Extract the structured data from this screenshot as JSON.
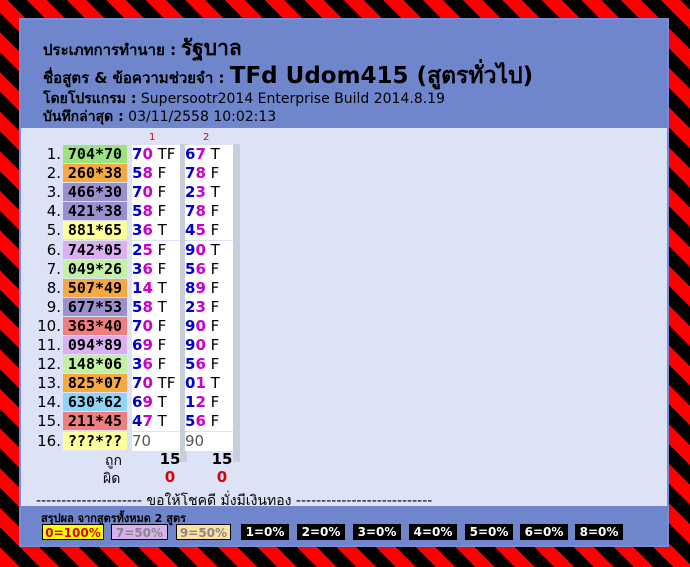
{
  "header": {
    "type_label": "ประเภทการทำนาย :",
    "type_value": "รัฐบาล",
    "formula_label": "ชื่อสูตร & ข้อความช่วยจำ :",
    "formula_value": "TFd Udom415 (สูตรทั่วไป)",
    "program_label": "โดยโปรแกรม :",
    "program_value": "Supersootr2014 Enterprise Build 2014.8.19",
    "saved_label": "บันทึกล่าสุด :",
    "saved_value": "03/11/2558 10:02:13"
  },
  "columns": [
    "1",
    "2"
  ],
  "rows": [
    {
      "n": "1.",
      "pair": "704*70",
      "bg": "#9be37e",
      "c1": [
        "7",
        "0",
        " TF"
      ],
      "c2": [
        "6",
        "7",
        " T"
      ]
    },
    {
      "n": "2.",
      "pair": "260*38",
      "bg": "#f6a841",
      "c1": [
        "5",
        "8",
        " F"
      ],
      "c2": [
        "7",
        "8",
        " F"
      ]
    },
    {
      "n": "3.",
      "pair": "466*30",
      "bg": "#9b8fce",
      "c1": [
        "7",
        "0",
        " F"
      ],
      "c2": [
        "2",
        "3",
        " T"
      ]
    },
    {
      "n": "4.",
      "pair": "421*38",
      "bg": "#9b8fce",
      "c1": [
        "5",
        "8",
        " F"
      ],
      "c2": [
        "7",
        "8",
        " F"
      ]
    },
    {
      "n": "5.",
      "pair": "881*65",
      "bg": "#ffff9c",
      "c1": [
        "3",
        "6",
        " T"
      ],
      "c2": [
        "4",
        "5",
        " F"
      ]
    },
    {
      "n": "6.",
      "pair": "742*05",
      "bg": "#d9b1f0",
      "c1": [
        "2",
        "5",
        " F"
      ],
      "c2": [
        "9",
        "0",
        " T"
      ]
    },
    {
      "n": "7.",
      "pair": "049*26",
      "bg": "#c4f0a4",
      "c1": [
        "3",
        "6",
        " F"
      ],
      "c2": [
        "5",
        "6",
        " F"
      ]
    },
    {
      "n": "8.",
      "pair": "507*49",
      "bg": "#f6a841",
      "c1": [
        "1",
        "4",
        " T"
      ],
      "c2": [
        "8",
        "9",
        " F"
      ]
    },
    {
      "n": "9.",
      "pair": "677*53",
      "bg": "#9b8fce",
      "c1": [
        "5",
        "8",
        " T"
      ],
      "c2": [
        "2",
        "3",
        " F"
      ]
    },
    {
      "n": "10.",
      "pair": "363*40",
      "bg": "#ef7f7f",
      "c1": [
        "7",
        "0",
        " F"
      ],
      "c2": [
        "9",
        "0",
        " F"
      ]
    },
    {
      "n": "11.",
      "pair": "094*89",
      "bg": "#d9b1f0",
      "c1": [
        "6",
        "9",
        " F"
      ],
      "c2": [
        "9",
        "0",
        " F"
      ]
    },
    {
      "n": "12.",
      "pair": "148*06",
      "bg": "#c4f0a4",
      "c1": [
        "3",
        "6",
        " F"
      ],
      "c2": [
        "5",
        "6",
        " F"
      ]
    },
    {
      "n": "13.",
      "pair": "825*07",
      "bg": "#f6a841",
      "c1": [
        "7",
        "0",
        " TF"
      ],
      "c2": [
        "0",
        "1",
        " T"
      ]
    },
    {
      "n": "14.",
      "pair": "630*62",
      "bg": "#8fd3f5",
      "c1": [
        "6",
        "9",
        " T"
      ],
      "c2": [
        "1",
        "2",
        " F"
      ]
    },
    {
      "n": "15.",
      "pair": "211*45",
      "bg": "#ef7f7f",
      "c1": [
        "4",
        "7",
        " T"
      ],
      "c2": [
        "5",
        "6",
        " F"
      ]
    },
    {
      "n": "16.",
      "pair": "???*??",
      "bg": "#ffff9c",
      "c1": [
        "70",
        "",
        ""
      ],
      "c2": [
        "90",
        "",
        ""
      ]
    }
  ],
  "totals": {
    "correct_label": "ถูก",
    "wrong_label": "ผิด",
    "correct": [
      "15",
      "15"
    ],
    "wrong": [
      "0",
      "0"
    ]
  },
  "divider_text": "--------------------- ขอให้โชคดี มั่งมีเงินทอง ---------------------------",
  "footer": {
    "title": "สรุปผล จากสูตรทั้งหมด 2 สูตร",
    "badges": [
      {
        "text": "0=100%",
        "bg": "#ffff00",
        "fg": "#dd0000"
      },
      {
        "text": "7=50%",
        "bg": "#d9b1f0",
        "fg": "#888888"
      },
      {
        "text": "9=50%",
        "bg": "#ffe0a0",
        "fg": "#888888"
      },
      {
        "text": "1=0%",
        "bg": "#000000",
        "fg": "#ffffff"
      },
      {
        "text": "2=0%",
        "bg": "#000000",
        "fg": "#ffffff"
      },
      {
        "text": "3=0%",
        "bg": "#000000",
        "fg": "#ffffff"
      },
      {
        "text": "4=0%",
        "bg": "#000000",
        "fg": "#ffffff"
      },
      {
        "text": "5=0%",
        "bg": "#000000",
        "fg": "#ffffff"
      },
      {
        "text": "6=0%",
        "bg": "#000000",
        "fg": "#ffffff"
      },
      {
        "text": "8=0%",
        "bg": "#000000",
        "fg": "#ffffff"
      }
    ]
  }
}
